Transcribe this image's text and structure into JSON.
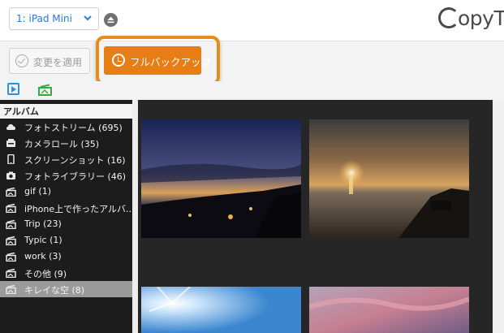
{
  "device": {
    "selected": "1: iPad Mini"
  },
  "brand": {
    "logo_text": "opyTra"
  },
  "toolbar": {
    "apply_label": "変更を適用",
    "fullbackup_label": "フルバックアップ"
  },
  "tabs": {
    "video_icon": "video-play-icon",
    "photo_icon": "photo-album-icon"
  },
  "sidebar": {
    "title": "アルバム",
    "items": [
      {
        "label": "フォトストリーム",
        "count": "(695)",
        "icon": "cloud-icon"
      },
      {
        "label": "カメラロール",
        "count": "(35)",
        "icon": "camera-roll-icon"
      },
      {
        "label": "スクリーンショット",
        "count": "(16)",
        "icon": "phone-icon"
      },
      {
        "label": "フォトライブラリー",
        "count": "(46)",
        "icon": "camera-icon"
      },
      {
        "label": "gif",
        "count": "(1)",
        "icon": "album-icon"
      },
      {
        "label": "iPhone上で作ったアルバ...",
        "count": "",
        "icon": "album-icon"
      },
      {
        "label": "Trip",
        "count": "(23)",
        "icon": "album-icon"
      },
      {
        "label": "Typic",
        "count": "(1)",
        "icon": "album-icon"
      },
      {
        "label": "work",
        "count": "(3)",
        "icon": "album-icon"
      },
      {
        "label": "その他",
        "count": "(9)",
        "icon": "album-icon"
      },
      {
        "label": "キレイな空",
        "count": "(8)",
        "icon": "album-icon",
        "selected": true
      }
    ]
  },
  "colors": {
    "accent_orange": "#e77d15",
    "highlight_ring": "#e68c1d",
    "link_blue": "#2a7bd1",
    "sidebar_bg": "#1c1c1c",
    "selected_bg": "#9b9b9b",
    "gallery_bg": "#262626"
  },
  "gallery": {
    "photos": [
      {
        "name": "photo-city-night-sunset"
      },
      {
        "name": "photo-sea-sunset"
      },
      {
        "name": "photo-sun-blue-sky"
      },
      {
        "name": "photo-pink-clouds"
      }
    ]
  }
}
